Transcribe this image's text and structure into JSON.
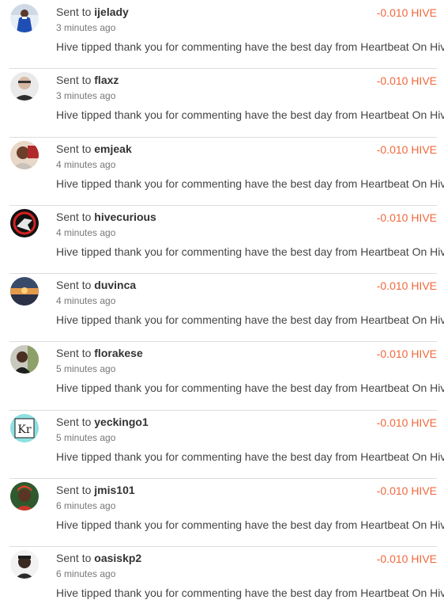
{
  "sent_prefix": "Sent to",
  "transfers": [
    {
      "user": "ijelady",
      "time": "3 minutes ago",
      "amount": "-0.010 HIVE",
      "memo": "Hive tipped thank you for commenting have the best day from Heartbeat On Hive",
      "avatar": "ijelady-avatar"
    },
    {
      "user": "flaxz",
      "time": "3 minutes ago",
      "amount": "-0.010 HIVE",
      "memo": "Hive tipped thank you for commenting have the best day from Heartbeat On Hive",
      "avatar": "flaxz-avatar"
    },
    {
      "user": "emjeak",
      "time": "4 minutes ago",
      "amount": "-0.010 HIVE",
      "memo": "Hive tipped thank you for commenting have the best day from Heartbeat On Hive",
      "avatar": "emjeak-avatar"
    },
    {
      "user": "hivecurious",
      "time": "4 minutes ago",
      "amount": "-0.010 HIVE",
      "memo": "Hive tipped thank you for commenting have the best day from Heartbeat On Hive",
      "avatar": "hivecurious-avatar"
    },
    {
      "user": "duvinca",
      "time": "4 minutes ago",
      "amount": "-0.010 HIVE",
      "memo": "Hive tipped thank you for commenting have the best day from Heartbeat On Hive",
      "avatar": "duvinca-avatar"
    },
    {
      "user": "florakese",
      "time": "5 minutes ago",
      "amount": "-0.010 HIVE",
      "memo": "Hive tipped thank you for commenting have the best day from Heartbeat On Hive",
      "avatar": "florakese-avatar"
    },
    {
      "user": "yeckingo1",
      "time": "5 minutes ago",
      "amount": "-0.010 HIVE",
      "memo": "Hive tipped thank you for commenting have the best day from Heartbeat On Hive",
      "avatar": "yeckingo1-avatar",
      "avatar_text": "Kr"
    },
    {
      "user": "jmis101",
      "time": "6 minutes ago",
      "amount": "-0.010 HIVE",
      "memo": "Hive tipped thank you for commenting have the best day from Heartbeat On Hive",
      "avatar": "jmis101-avatar"
    },
    {
      "user": "oasiskp2",
      "time": "6 minutes ago",
      "amount": "-0.010 HIVE",
      "memo": "Hive tipped thank you for commenting have the best day from Heartbeat On Hive",
      "avatar": "oasiskp2-avatar"
    }
  ],
  "colors": {
    "amount": "#f0683c",
    "divider": "#dddddd"
  }
}
